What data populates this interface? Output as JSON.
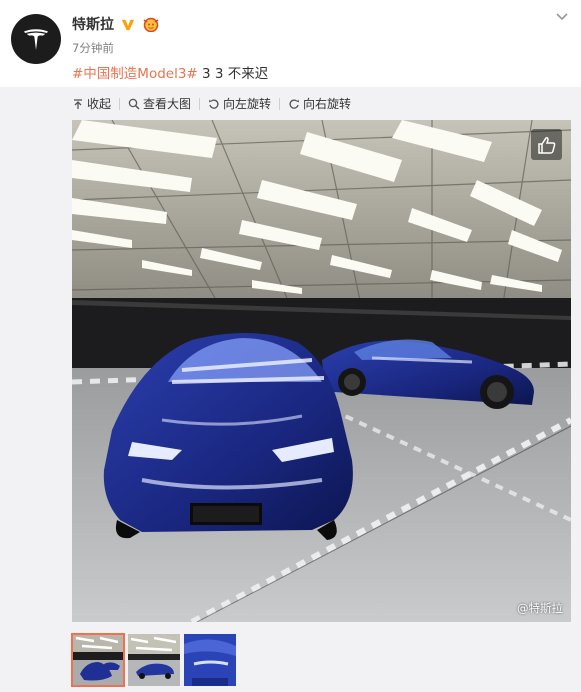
{
  "post": {
    "username": "特斯拉",
    "time": "7分钟前",
    "hashtag": "#中国制造Model3#",
    "text": " 3 3 不来迟"
  },
  "icons": {
    "avatar": "tesla-logo",
    "verified": "verified-v-icon",
    "badge": "member-badge-icon",
    "menu": "chevron-down-icon",
    "like": "thumbs-up-icon"
  },
  "toolbar": {
    "collapse": "收起",
    "view_large": "查看大图",
    "rotate_left": "向左旋转",
    "rotate_right": "向右旋转"
  },
  "image": {
    "watermark": "@特斯拉",
    "thumbnail_count": 3,
    "active_thumbnail": 1
  },
  "colors": {
    "accent": "#eb7350",
    "verified": "#ffa00a",
    "car_blue": "#1e2f8c"
  }
}
